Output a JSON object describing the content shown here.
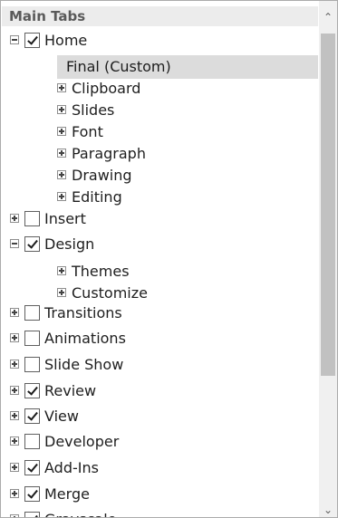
{
  "header": {
    "title": "Main Tabs"
  },
  "tree": [
    {
      "label": "Home",
      "expander": "minus",
      "checkbox": "checked",
      "level": 0
    },
    {
      "label": "Final (Custom)",
      "expander": "none",
      "checkbox": "none",
      "level": 1,
      "selected": true
    },
    {
      "label": "Clipboard",
      "expander": "plus",
      "checkbox": "none",
      "level": 1
    },
    {
      "label": "Slides",
      "expander": "plus",
      "checkbox": "none",
      "level": 1
    },
    {
      "label": "Font",
      "expander": "plus",
      "checkbox": "none",
      "level": 1
    },
    {
      "label": "Paragraph",
      "expander": "plus",
      "checkbox": "none",
      "level": 1
    },
    {
      "label": "Drawing",
      "expander": "plus",
      "checkbox": "none",
      "level": 1
    },
    {
      "label": "Editing",
      "expander": "plus",
      "checkbox": "none",
      "level": 1
    },
    {
      "label": "Insert",
      "expander": "plus",
      "checkbox": "unchecked",
      "level": 0
    },
    {
      "label": "Design",
      "expander": "minus",
      "checkbox": "checked",
      "level": 0
    },
    {
      "label": "Themes",
      "expander": "plus",
      "checkbox": "none",
      "level": 1
    },
    {
      "label": "Customize",
      "expander": "plus",
      "checkbox": "none",
      "level": 1
    },
    {
      "label": "Transitions",
      "expander": "plus",
      "checkbox": "unchecked",
      "level": 0
    },
    {
      "label": "Animations",
      "expander": "plus",
      "checkbox": "unchecked",
      "level": 0
    },
    {
      "label": "Slide Show",
      "expander": "plus",
      "checkbox": "unchecked",
      "level": 0
    },
    {
      "label": "Review",
      "expander": "plus",
      "checkbox": "checked",
      "level": 0
    },
    {
      "label": "View",
      "expander": "plus",
      "checkbox": "checked",
      "level": 0
    },
    {
      "label": "Developer",
      "expander": "plus",
      "checkbox": "unchecked",
      "level": 0
    },
    {
      "label": "Add-Ins",
      "expander": "plus",
      "checkbox": "checked",
      "level": 0
    },
    {
      "label": "Merge",
      "expander": "plus",
      "checkbox": "checked",
      "level": 0
    },
    {
      "label": "Grayscale",
      "expander": "plus",
      "checkbox": "checked",
      "level": 0
    }
  ],
  "scrollbar": {
    "up_arrow": "⌃",
    "down_arrow": "⌄",
    "up_icon": "chevron-up-icon",
    "down_icon": "chevron-down-icon"
  },
  "colors": {
    "header_bg": "#ececec",
    "selected_bg": "#dcdcdc",
    "scroll_thumb": "#c1c1c1"
  }
}
